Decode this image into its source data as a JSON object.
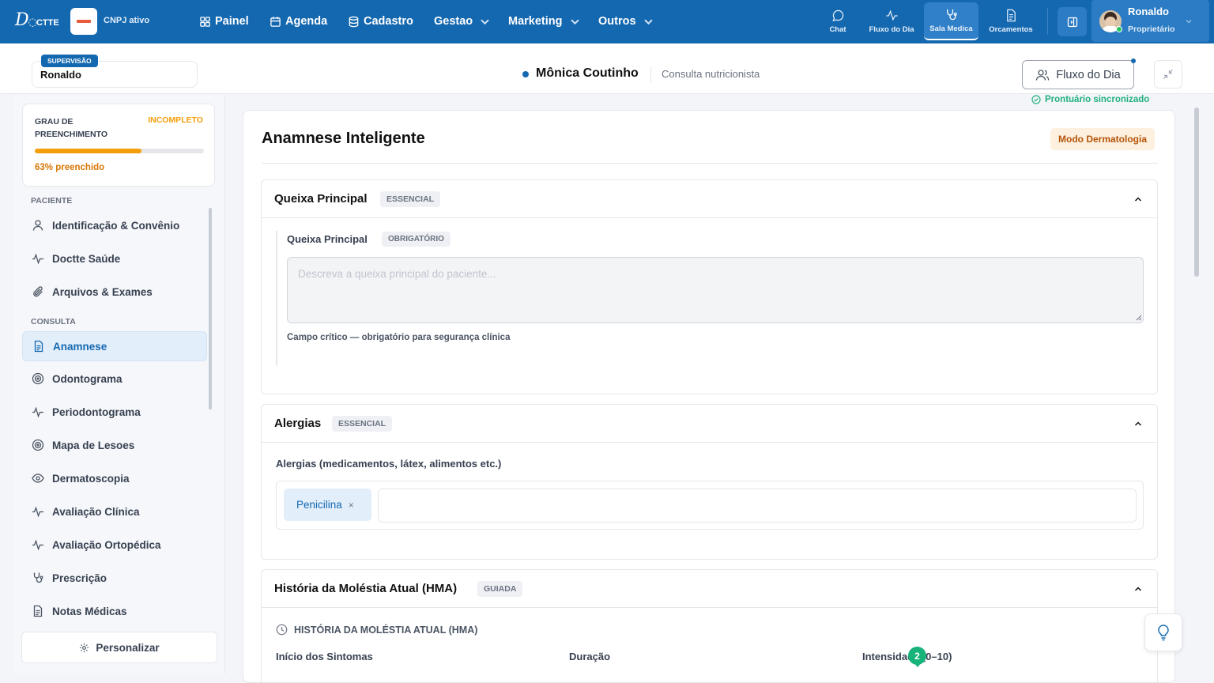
{
  "topbar": {
    "logo": "Doctte",
    "cnpj": "CNPJ ativo",
    "nav": [
      {
        "label": "Painel",
        "icon": "grid-icon"
      },
      {
        "label": "Agenda",
        "icon": "calendar-icon"
      },
      {
        "label": "Cadastro",
        "icon": "database-icon"
      },
      {
        "label": "Gestao",
        "icon": "chevron-down-icon"
      },
      {
        "label": "Marketing",
        "icon": "chevron-down-icon"
      },
      {
        "label": "Outros",
        "icon": "chevron-down-icon"
      }
    ],
    "right_nav": [
      {
        "label": "Chat",
        "icon": "chat-icon"
      },
      {
        "label": "Fluxo do Dia",
        "icon": "activity-icon"
      },
      {
        "label": "Sala Medica",
        "icon": "stethoscope-icon",
        "active": true
      },
      {
        "label": "Orcamentos",
        "icon": "document-icon"
      }
    ],
    "user": {
      "name": "Ronaldo",
      "role": "Proprietário"
    }
  },
  "header": {
    "supervision_badge": "SUPERVISÃO",
    "supervisor": "Ronaldo",
    "patient_name": "Mônica Coutinho",
    "consult_type": "Consulta nutricionista",
    "fluxo_button": "Fluxo do Dia"
  },
  "sidebar": {
    "progress": {
      "label": "GRAU DE PREENCHIMENTO",
      "status": "INCOMPLETO",
      "percent": 63,
      "text": "63% preenchido"
    },
    "section_patient": "PACIENTE",
    "patient_items": [
      {
        "label": "Identificação & Convênio",
        "icon": "user-icon"
      },
      {
        "label": "Doctte Saúde",
        "icon": "activity-icon"
      },
      {
        "label": "Arquivos & Exames",
        "icon": "paperclip-icon"
      }
    ],
    "section_consult": "CONSULTA",
    "consult_items": [
      {
        "label": "Anamnese",
        "icon": "document-icon",
        "active": true
      },
      {
        "label": "Odontograma",
        "icon": "target-icon"
      },
      {
        "label": "Periodontograma",
        "icon": "activity-icon"
      },
      {
        "label": "Mapa de Lesoes",
        "icon": "target-icon"
      },
      {
        "label": "Dermatoscopia",
        "icon": "eye-icon"
      },
      {
        "label": "Avaliação Clínica",
        "icon": "activity-icon"
      },
      {
        "label": "Avaliação Ortopédica",
        "icon": "activity-icon"
      },
      {
        "label": "Prescrição",
        "icon": "stethoscope-icon"
      },
      {
        "label": "Notas Médicas",
        "icon": "document-icon"
      }
    ],
    "personalize": "Personalizar"
  },
  "main": {
    "sync_status": "Prontuário sincronizado",
    "title": "Anamnese Inteligente",
    "mode_tag": "Modo Dermatologia",
    "queixa": {
      "title": "Queixa Principal",
      "tag": "ESSENCIAL",
      "field_label": "Queixa Principal",
      "field_tag": "OBRIGATÓRIO",
      "placeholder": "Descreva a queixa principal do paciente...",
      "help": "Campo crítico — obrigatório para segurança clínica"
    },
    "alergias": {
      "title": "Alergias",
      "tag": "ESSENCIAL",
      "field_label": "Alergias (medicamentos, látex, alimentos etc.)",
      "chips": [
        "Penicilina"
      ],
      "remove_glyph": "×"
    },
    "hma": {
      "title": "História da Moléstia Atual (HMA)",
      "tag": "GUIADA",
      "sub_title": "HISTÓRIA DA MOLÉSTIA ATUAL (HMA)",
      "col1": "Início dos Sintomas",
      "col2": "Duração",
      "col3": "Intensidade (0–10)"
    },
    "notification_count": "2"
  },
  "colors": {
    "brand": "#1468b0",
    "warning": "#f59e0b",
    "success": "#17b37a"
  }
}
